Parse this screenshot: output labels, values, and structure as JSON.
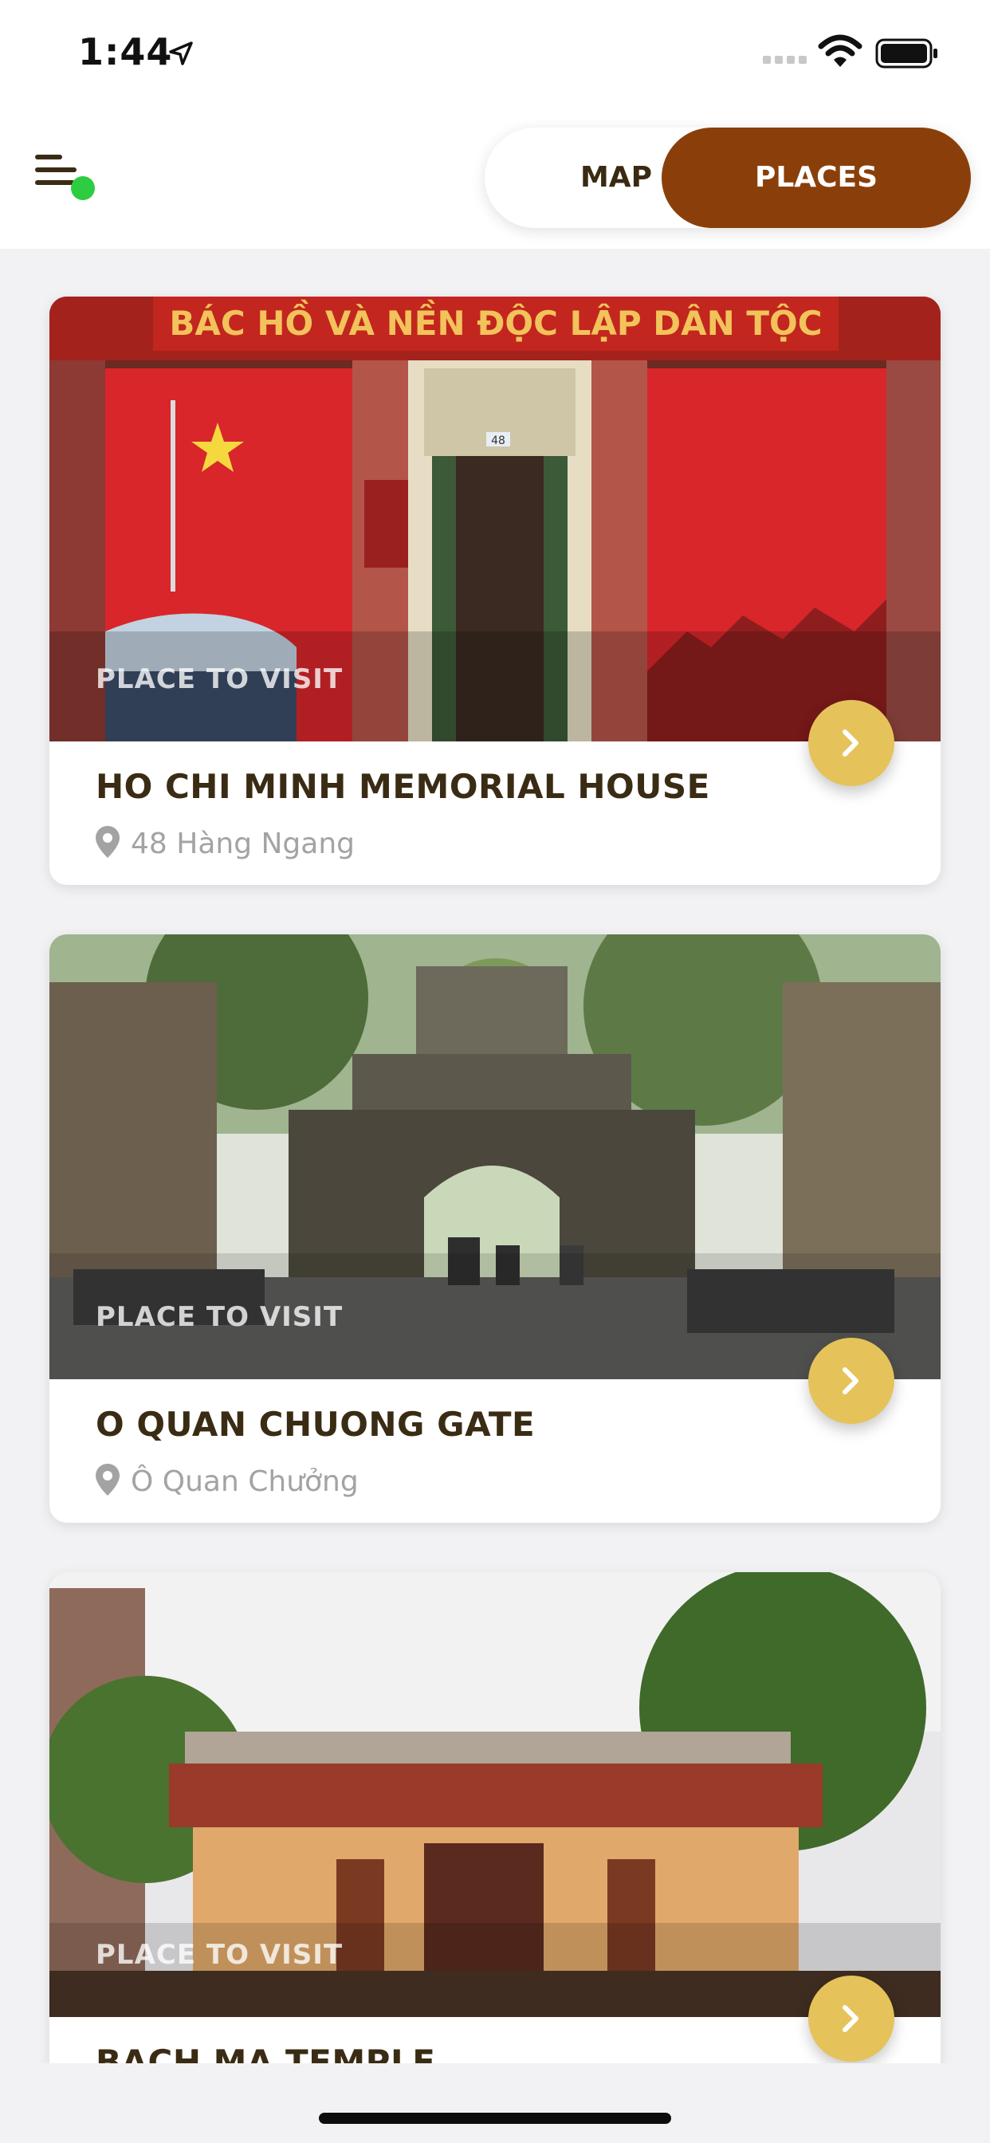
{
  "status_bar": {
    "time": "1:44",
    "icons": [
      "location-arrow-icon",
      "signal-icon",
      "wifi-icon",
      "battery-icon"
    ]
  },
  "header": {
    "menu_icon": "menu-icon",
    "online_indicator_color": "#2ecc40",
    "segmented": {
      "map_label": "MAP",
      "places_label": "PLACES",
      "selected": "PLACES"
    }
  },
  "colors": {
    "accent": "#8a3f0a",
    "button": "#e5c35a",
    "title": "#3a2c14",
    "subtitle": "#a3a3a3"
  },
  "places": [
    {
      "tag": "PLACE TO VISIT",
      "title": "HO CHI MINH MEMORIAL HOUSE",
      "address": "48 Hàng Ngang",
      "banner": "BÁC HỒ VÀ NỀN ĐỘC LẬP DÂN TỘC",
      "house_number": "48"
    },
    {
      "tag": "PLACE TO VISIT",
      "title": "O QUAN CHUONG GATE",
      "address": "Ô Quan Chưởng"
    },
    {
      "tag": "PLACE TO VISIT",
      "title": "BACH MA TEMPLE",
      "address": ""
    }
  ]
}
